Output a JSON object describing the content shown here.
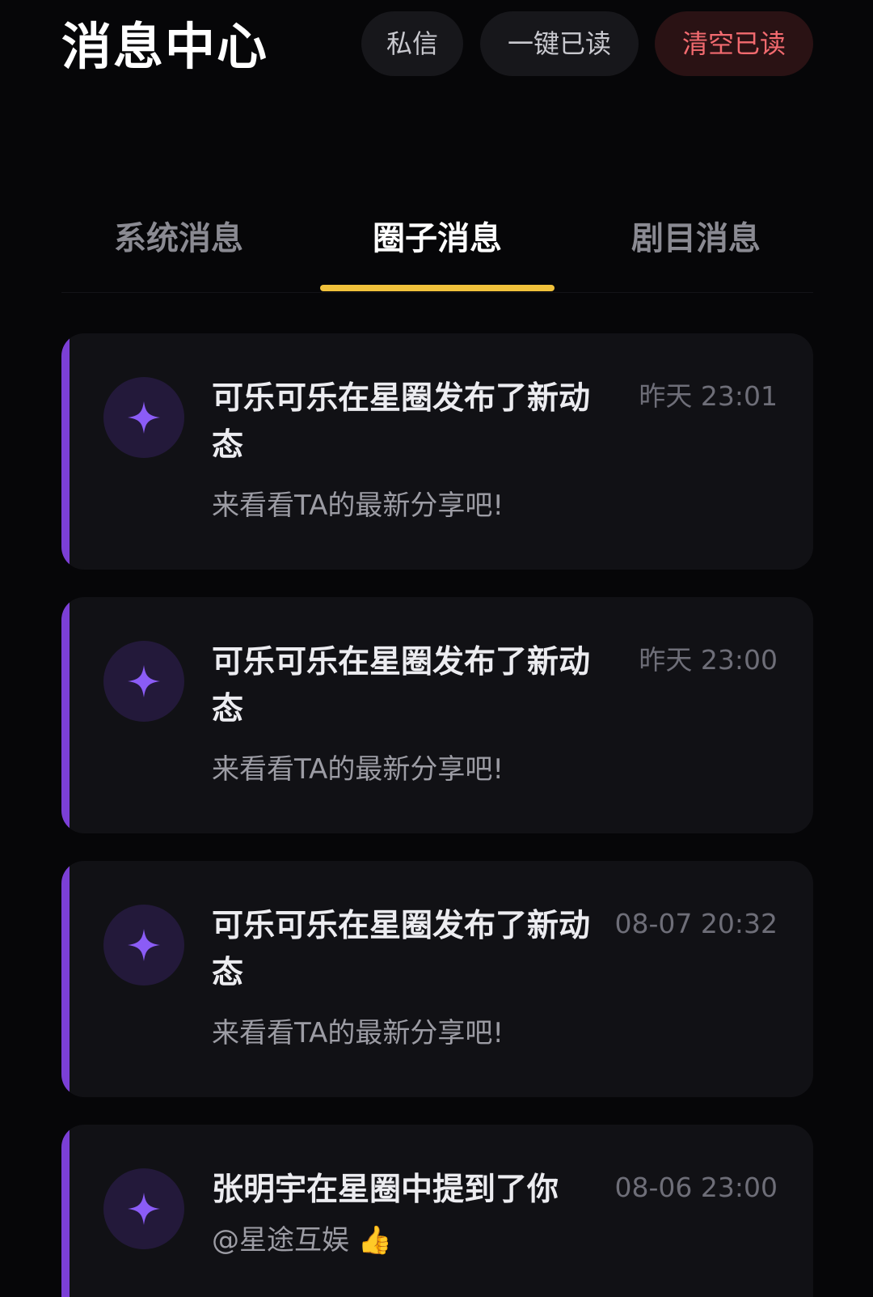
{
  "header": {
    "title": "消息中心",
    "buttons": {
      "dm": "私信",
      "read_all": "一键已读",
      "clear_read": "清空已读"
    }
  },
  "tabs": [
    {
      "label": "系统消息",
      "active": false
    },
    {
      "label": "圈子消息",
      "active": true
    },
    {
      "label": "剧目消息",
      "active": false
    }
  ],
  "colors": {
    "background": "#060608",
    "card": "#111115",
    "accent_bar": "#7b3fd6",
    "tab_indicator": "#f0c13b",
    "danger": "#f26a6f",
    "avatar_icon": "#8b5cf6"
  },
  "messages": [
    {
      "icon": "sparkle-icon",
      "title": "可乐可乐在星圈发布了新动态",
      "time": "昨天 23:01",
      "body": "来看看TA的最新分享吧!"
    },
    {
      "icon": "sparkle-icon",
      "title": "可乐可乐在星圈发布了新动态",
      "time": "昨天 23:00",
      "body": "来看看TA的最新分享吧!"
    },
    {
      "icon": "sparkle-icon",
      "title": "可乐可乐在星圈发布了新动态",
      "time": "08-07 20:32",
      "body": "来看看TA的最新分享吧!"
    },
    {
      "icon": "sparkle-icon",
      "title": "张明宇在星圈中提到了你",
      "time": "08-06 23:00",
      "body": "@星途互娱 👍"
    }
  ]
}
